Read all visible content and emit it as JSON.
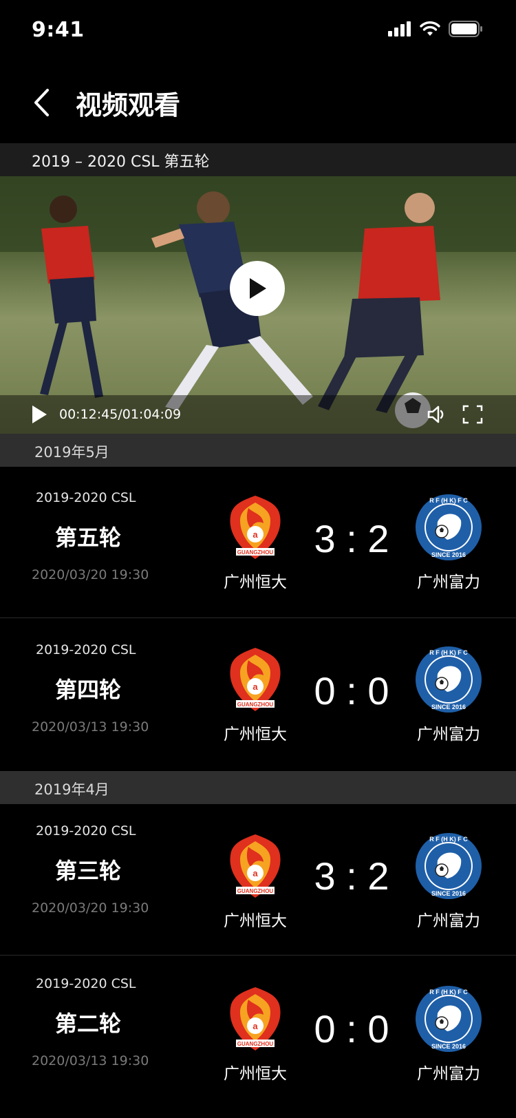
{
  "status_bar": {
    "time": "9:41"
  },
  "nav": {
    "title": "视频观看"
  },
  "video": {
    "title": "2019 – 2020 CSL 第五轮",
    "time_display": "00:12:45/01:04:09"
  },
  "months": [
    {
      "label": "2019年5月",
      "matches": [
        {
          "league": "2019-2020 CSL",
          "round": "第五轮",
          "date": "2020/03/20 19:30",
          "home": "广州恒大",
          "away": "广州富力",
          "home_score": "3",
          "away_score": "2"
        },
        {
          "league": "2019-2020 CSL",
          "round": "第四轮",
          "date": "2020/03/13 19:30",
          "home": "广州恒大",
          "away": "广州富力",
          "home_score": "0",
          "away_score": "0"
        }
      ]
    },
    {
      "label": "2019年4月",
      "matches": [
        {
          "league": "2019-2020 CSL",
          "round": "第三轮",
          "date": "2020/03/20 19:30",
          "home": "广州恒大",
          "away": "广州富力",
          "home_score": "3",
          "away_score": "2"
        },
        {
          "league": "2019-2020 CSL",
          "round": "第二轮",
          "date": "2020/03/13 19:30",
          "home": "广州恒大",
          "away": "广州富力",
          "home_score": "0",
          "away_score": "0"
        }
      ]
    }
  ],
  "logos": {
    "home_text": "GUANGZHOU",
    "away_text": "SINCE 2016",
    "away_ring": "R F (H K) F C"
  },
  "colors": {
    "background": "#000000",
    "month_bar": "#2f2f2f",
    "home_logo": "#e0301e",
    "away_logo": "#1f5fa8"
  }
}
